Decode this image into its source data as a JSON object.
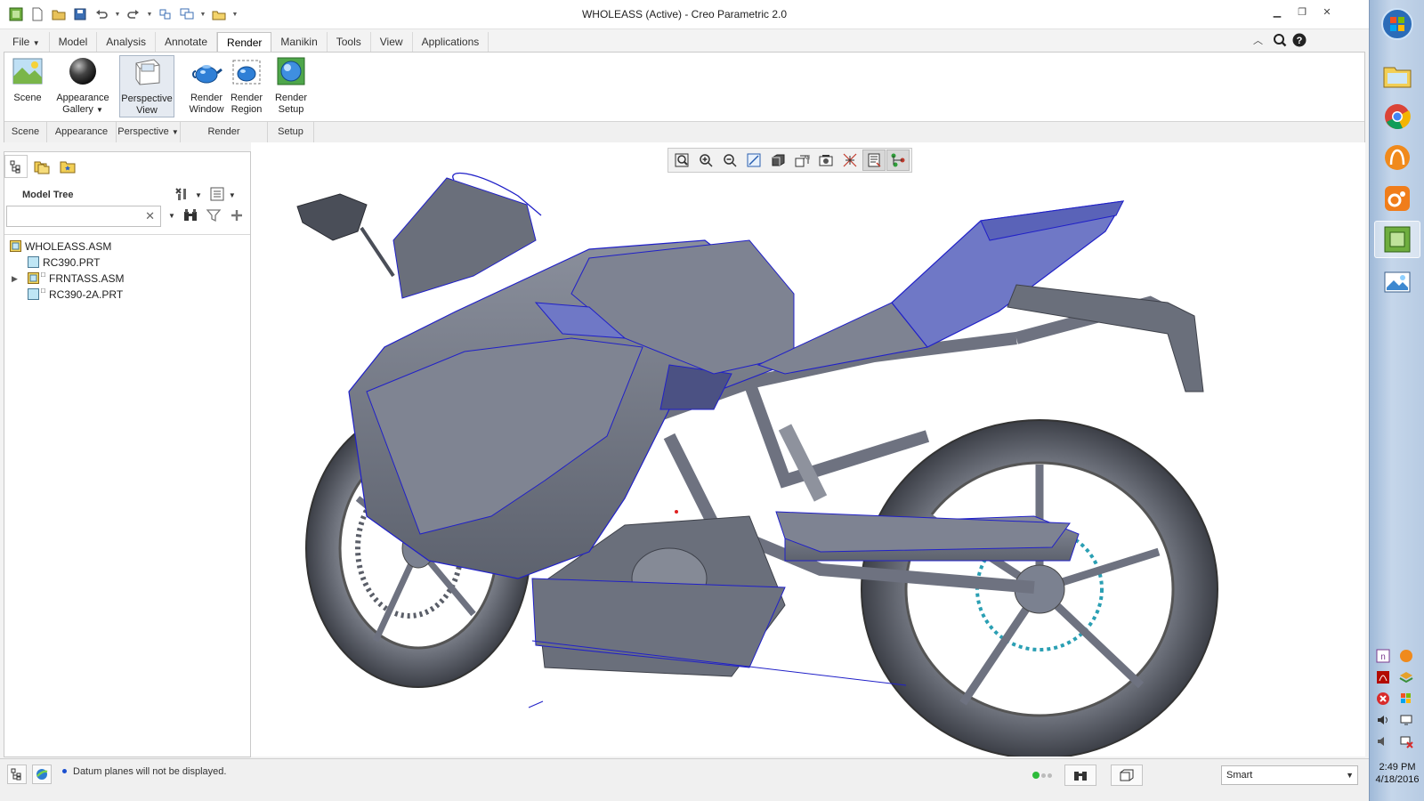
{
  "window": {
    "title": "WHOLEASS (Active) - Creo Parametric 2.0"
  },
  "ribbon_tabs": [
    {
      "label": "File",
      "has_menu": true
    },
    {
      "label": "Model"
    },
    {
      "label": "Analysis"
    },
    {
      "label": "Annotate"
    },
    {
      "label": "Render",
      "active": true
    },
    {
      "label": "Manikin"
    },
    {
      "label": "Tools"
    },
    {
      "label": "View"
    },
    {
      "label": "Applications"
    }
  ],
  "ribbon": {
    "scene": {
      "label": "Scene"
    },
    "appearance_gallery": {
      "label1": "Appearance",
      "label2": "Gallery"
    },
    "perspective_view": {
      "label1": "Perspective",
      "label2": "View",
      "pressed": true
    },
    "render_window": {
      "label1": "Render",
      "label2": "Window"
    },
    "render_region": {
      "label1": "Render",
      "label2": "Region"
    },
    "render_setup": {
      "label1": "Render",
      "label2": "Setup"
    },
    "groups": [
      "Scene",
      "Appearance",
      "Perspective",
      "Render",
      "Setup"
    ]
  },
  "model_tree": {
    "title": "Model Tree",
    "search_value": "",
    "items": [
      {
        "label": "WHOLEASS.ASM",
        "type": "assembly",
        "level": 0
      },
      {
        "label": "RC390.PRT",
        "type": "part",
        "level": 1
      },
      {
        "label": "FRNTASS.ASM",
        "type": "assembly",
        "level": 1,
        "expandable": true
      },
      {
        "label": "RC390-2A.PRT",
        "type": "part",
        "level": 1
      }
    ]
  },
  "status": {
    "message": "Datum planes will not be displayed.",
    "selection_filter": "Smart"
  },
  "taskbar": {
    "time": "2:49 PM",
    "date": "4/18/2016"
  },
  "colors": {
    "model_gray": "#7b8190",
    "edge_blue": "#2020c8",
    "highlight_blue": "#5a63b8",
    "taskbar": "#b7cbe3"
  }
}
